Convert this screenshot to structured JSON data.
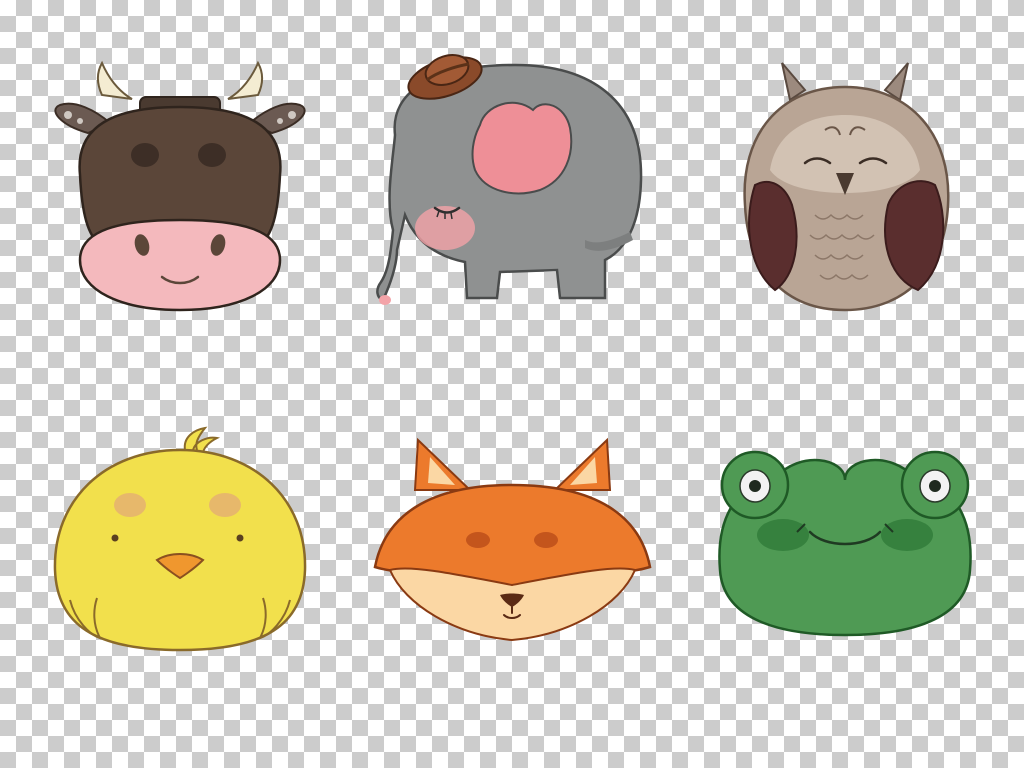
{
  "canvas": {
    "background": "transparency-checkerboard",
    "checker_colors": [
      "#ffffff",
      "#cccccc"
    ]
  },
  "illustrations": [
    {
      "name": "cow",
      "style": "watercolor",
      "main_color": "#5b4639",
      "accent_color": "#f4b9bd"
    },
    {
      "name": "elephant",
      "style": "watercolor",
      "main_color": "#8f9191",
      "accent_color": "#ee8f97"
    },
    {
      "name": "owl",
      "style": "watercolor",
      "main_color": "#b9a595",
      "accent_color": "#5a2e2e"
    },
    {
      "name": "chick",
      "style": "watercolor",
      "main_color": "#f2e04c",
      "accent_color": "#f0972e"
    },
    {
      "name": "fox",
      "style": "watercolor",
      "main_color": "#ec7a2c",
      "accent_color": "#fbd7a4"
    },
    {
      "name": "frog",
      "style": "watercolor",
      "main_color": "#4f9a54",
      "accent_color": "#f2f2f2"
    }
  ]
}
